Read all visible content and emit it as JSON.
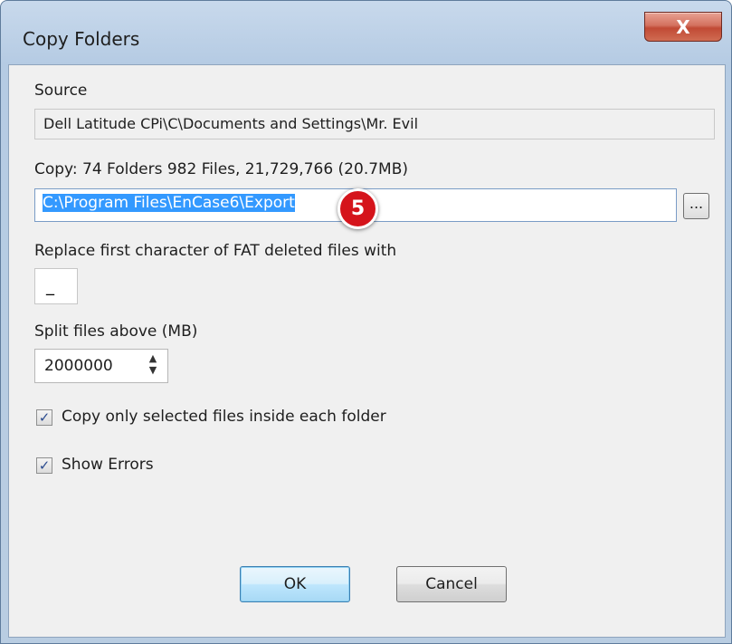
{
  "window": {
    "title": "Copy Folders",
    "close_label": "X"
  },
  "source": {
    "label": "Source",
    "value": "Dell Latitude CPi\\C\\Documents and Settings\\Mr. Evil"
  },
  "copy": {
    "label": "Copy: 74 Folders 982 Files, 21,729,766 (20.7MB)",
    "path_value": "C:\\Program Files\\EnCase6\\Export",
    "browse_label": "..."
  },
  "annotation": {
    "step_number": "5",
    "color": "#d5141b"
  },
  "replace": {
    "label": "Replace first character of FAT deleted files with",
    "value": "_"
  },
  "split": {
    "label": "Split files above (MB)",
    "value": "2000000",
    "up_arrow": "▲",
    "down_arrow": "▼"
  },
  "options": {
    "copy_selected": {
      "label": "Copy only selected files inside each folder",
      "checked": true,
      "mark": "✓"
    },
    "show_errors": {
      "label": "Show Errors",
      "checked": true,
      "mark": "✓"
    }
  },
  "buttons": {
    "ok": "OK",
    "cancel": "Cancel"
  }
}
